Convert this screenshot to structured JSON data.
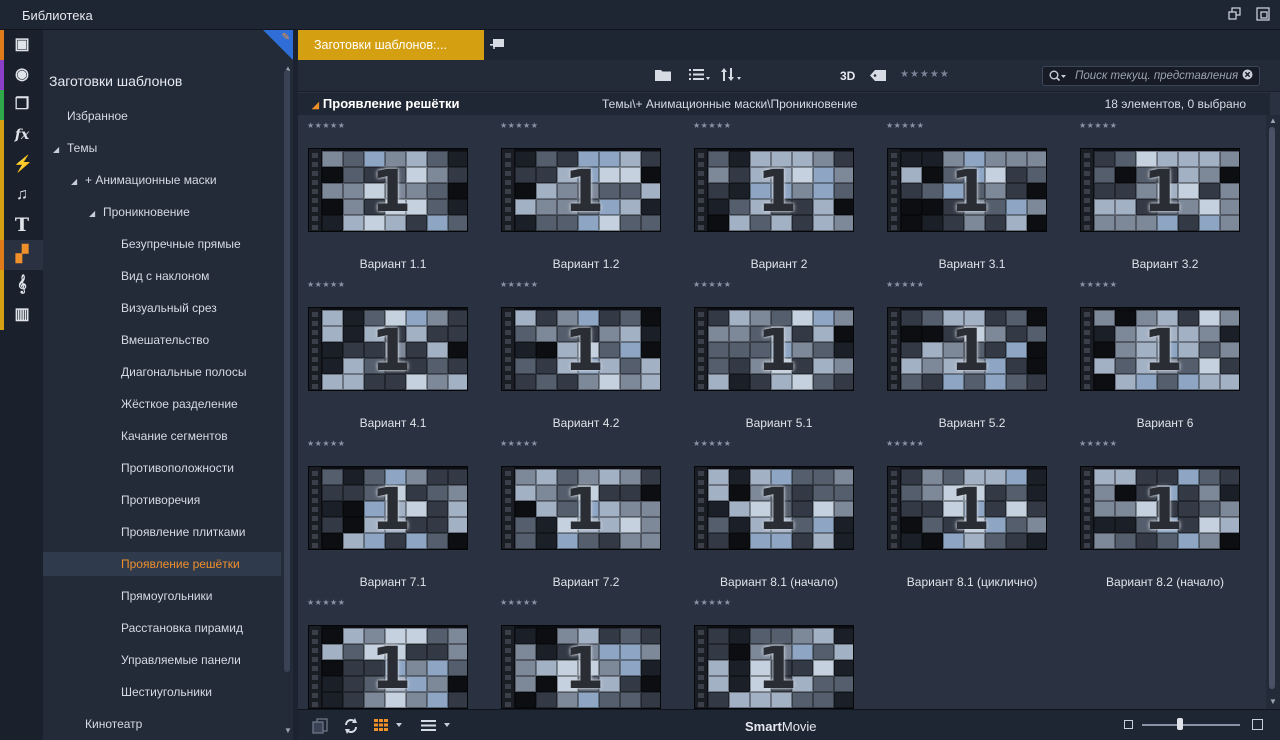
{
  "window": {
    "title": "Библиотека"
  },
  "leftbar": {
    "items": [
      {
        "icon": "box-icon",
        "color": "#e07b1a",
        "glyph": "▣"
      },
      {
        "icon": "film-reel-icon",
        "color": "#8a3fc9",
        "glyph": "◉"
      },
      {
        "icon": "copy-icon",
        "color": "#2fa84a",
        "glyph": "❐"
      },
      {
        "icon": "fx-icon",
        "color": "#d4a012",
        "glyph": "fx"
      },
      {
        "icon": "lightning-icon",
        "color": "#d4a012",
        "glyph": "⚡"
      },
      {
        "icon": "music-note-icon",
        "color": "#d4a012",
        "glyph": "♫"
      },
      {
        "icon": "text-icon",
        "color": "#d4a012",
        "glyph": "T"
      },
      {
        "icon": "template-icon",
        "color": "#e07b1a",
        "glyph": "▞"
      },
      {
        "icon": "treble-clef-icon",
        "color": "#d4a012",
        "glyph": "𝄞"
      },
      {
        "icon": "piano-icon",
        "color": "#d4a012",
        "glyph": "▥"
      }
    ]
  },
  "tree": {
    "heading": "Заготовки шаблонов",
    "rows": [
      {
        "label": "Избранное",
        "indent": 0,
        "expander": ""
      },
      {
        "label": "Темы",
        "indent": 0,
        "expander": "◢"
      },
      {
        "label": "+ Анимационные маски",
        "indent": 1,
        "expander": "◢"
      },
      {
        "label": "Проникновение",
        "indent": 2,
        "expander": "◢"
      },
      {
        "label": "Безупречные прямые",
        "indent": 3,
        "expander": ""
      },
      {
        "label": "Вид с наклоном",
        "indent": 3,
        "expander": ""
      },
      {
        "label": "Визуальный срез",
        "indent": 3,
        "expander": ""
      },
      {
        "label": "Вмешательство",
        "indent": 3,
        "expander": ""
      },
      {
        "label": "Диагональные полосы",
        "indent": 3,
        "expander": ""
      },
      {
        "label": "Жёсткое разделение",
        "indent": 3,
        "expander": ""
      },
      {
        "label": "Качание сегментов",
        "indent": 3,
        "expander": ""
      },
      {
        "label": "Противоположности",
        "indent": 3,
        "expander": ""
      },
      {
        "label": "Противоречия",
        "indent": 3,
        "expander": ""
      },
      {
        "label": "Проявление плитками",
        "indent": 3,
        "expander": ""
      },
      {
        "label": "Проявление решётки",
        "indent": 3,
        "expander": "",
        "selected": true
      },
      {
        "label": "Прямоугольники",
        "indent": 3,
        "expander": ""
      },
      {
        "label": "Расстановка пирамид",
        "indent": 3,
        "expander": ""
      },
      {
        "label": "Управляемые панели",
        "indent": 3,
        "expander": ""
      },
      {
        "label": "Шестиугольники",
        "indent": 3,
        "expander": ""
      },
      {
        "label": "Кинотеатр",
        "indent": 1,
        "expander": ""
      }
    ]
  },
  "tabs": {
    "active_label": "Заготовки шаблонов:..."
  },
  "toolbar": {
    "label_3d": "3D",
    "rating_stars": "★★★★★",
    "search_placeholder": "Поиск текущ. представления"
  },
  "crumb": {
    "title": "Проявление решётки",
    "path": "Темы\\+ Анимационные маски\\Проникновение",
    "count": "18 элементов, 0 выбрано"
  },
  "items": [
    {
      "name": "Вариант 1.1",
      "stars": "★★★★★",
      "pattern": 0
    },
    {
      "name": "Вариант 1.2",
      "stars": "★★★★★",
      "pattern": 1
    },
    {
      "name": "Вариант 2",
      "stars": "★★★★★",
      "pattern": 2
    },
    {
      "name": "Вариант 3.1",
      "stars": "★★★★★",
      "pattern": 3
    },
    {
      "name": "Вариант 3.2",
      "stars": "★★★★★",
      "pattern": 4
    },
    {
      "name": "Вариант 4.1",
      "stars": "★★★★★",
      "pattern": 5
    },
    {
      "name": "Вариант 4.2",
      "stars": "★★★★★",
      "pattern": 6
    },
    {
      "name": "Вариант 5.1",
      "stars": "★★★★★",
      "pattern": 7
    },
    {
      "name": "Вариант 5.2",
      "stars": "★★★★★",
      "pattern": 8
    },
    {
      "name": "Вариант 6",
      "stars": "★★★★★",
      "pattern": 9
    },
    {
      "name": "Вариант 7.1",
      "stars": "★★★★★",
      "pattern": 10
    },
    {
      "name": "Вариант 7.2",
      "stars": "★★★★★",
      "pattern": 11
    },
    {
      "name": "Вариант 8.1 (начало)",
      "stars": "★★★★★",
      "pattern": 12
    },
    {
      "name": "Вариант 8.1 (циклично)",
      "stars": "★★★★★",
      "pattern": 13
    },
    {
      "name": "Вариант 8.2 (начало)",
      "stars": "★★★★★",
      "pattern": 14
    },
    {
      "name": "",
      "stars": "★★★★★",
      "pattern": 15
    },
    {
      "name": "",
      "stars": "★★★★★",
      "pattern": 16
    },
    {
      "name": "",
      "stars": "★★★★★",
      "pattern": 17
    }
  ],
  "bottom": {
    "brand_bold": "Smart",
    "brand_rest": "Movie",
    "zoom_level": 0.38
  },
  "colors": {
    "accent": "#f0902a",
    "tab": "#d4a012",
    "selection": "#2f3a4d"
  }
}
